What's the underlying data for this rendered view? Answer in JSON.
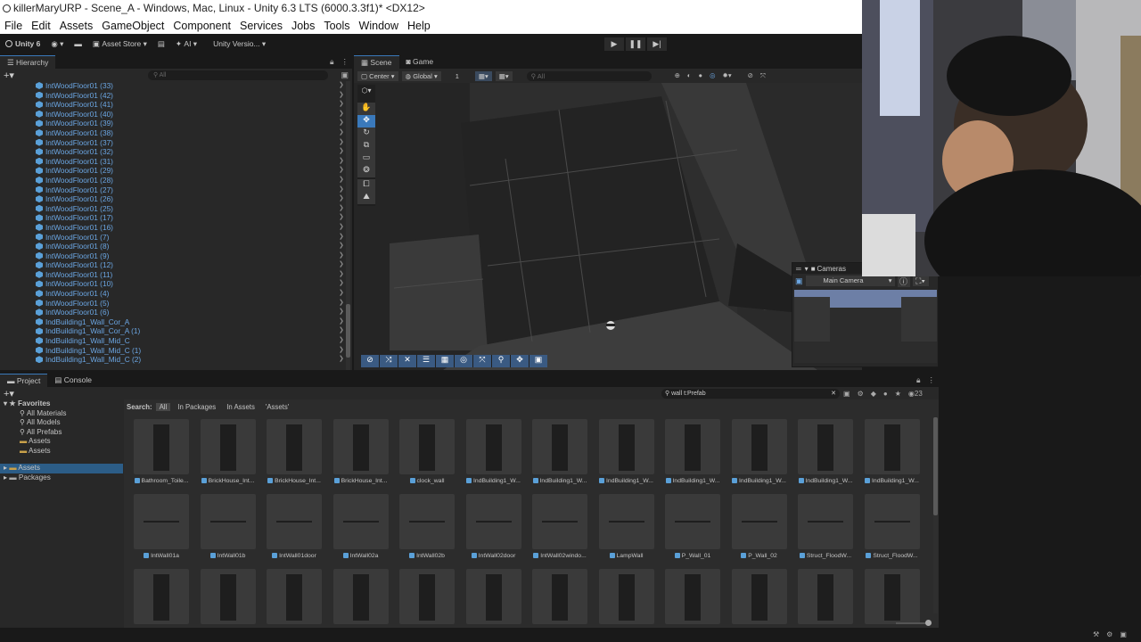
{
  "window": {
    "title": "killerMaryURP - Scene_A - Windows, Mac, Linux - Unity 6.3 LTS (6000.3.3f1)* <DX12>"
  },
  "menu": [
    "File",
    "Edit",
    "Assets",
    "GameObject",
    "Component",
    "Services",
    "Jobs",
    "Tools",
    "Window",
    "Help"
  ],
  "toolbar": {
    "unity_label": "Unity 6",
    "asset_store": "Asset Store",
    "ai": "AI",
    "version": "Unity Versio..."
  },
  "hierarchy": {
    "tab": "Hierarchy",
    "search_placeholder": "All",
    "items": [
      "IntWoodFloor01 (33)",
      "IntWoodFloor01 (42)",
      "IntWoodFloor01 (41)",
      "IntWoodFloor01 (40)",
      "IntWoodFloor01 (39)",
      "IntWoodFloor01 (38)",
      "IntWoodFloor01 (37)",
      "IntWoodFloor01 (32)",
      "IntWoodFloor01 (31)",
      "IntWoodFloor01 (29)",
      "IntWoodFloor01 (28)",
      "IntWoodFloor01 (27)",
      "IntWoodFloor01 (26)",
      "IntWoodFloor01 (25)",
      "IntWoodFloor01 (17)",
      "IntWoodFloor01 (16)",
      "IntWoodFloor01 (7)",
      "IntWoodFloor01 (8)",
      "IntWoodFloor01 (9)",
      "IntWoodFloor01 (12)",
      "IntWoodFloor01 (11)",
      "IntWoodFloor01 (10)",
      "IntWoodFloor01 (4)",
      "IntWoodFloor01 (5)",
      "IntWoodFloor01 (6)",
      "IndBuilding1_Wall_Cor_A",
      "IndBuilding1_Wall_Cor_A (1)",
      "IndBuilding1_Wall_Mid_C",
      "IndBuilding1_Wall_Mid_C (1)",
      "IndBuilding1_Wall_Mid_C (2)"
    ]
  },
  "scene": {
    "tab_scene": "Scene",
    "tab_game": "Game",
    "pivot": "Center",
    "space": "Global",
    "grid_value": "1",
    "search_placeholder": "All"
  },
  "cameras": {
    "title": "Cameras",
    "selected": "Main Camera"
  },
  "project": {
    "tab_project": "Project",
    "tab_console": "Console",
    "search_value": "wall t:Prefab",
    "count": "23",
    "search_label": "Search:",
    "filters": [
      "All",
      "In Packages",
      "In Assets",
      "'Assets'"
    ],
    "favorites_label": "Favorites",
    "favorites": [
      "All Materials",
      "All Models",
      "All Prefabs",
      "Assets",
      "Assets"
    ],
    "roots": [
      "Assets",
      "Packages"
    ],
    "assets_row1": [
      "Bathroom_Toile...",
      "BrickHouse_Int...",
      "BrickHouse_Int...",
      "BrickHouse_Int...",
      "clock_wall",
      "IndBuilding1_W...",
      "IndBuilding1_W...",
      "IndBuilding1_W...",
      "IndBuilding1_W...",
      "IndBuilding1_W...",
      "IndBuilding1_W...",
      "IndBuilding1_W..."
    ],
    "assets_row2": [
      "IntWall01a",
      "IntWall01b",
      "IntWall01door",
      "IntWall02a",
      "IntWall02b",
      "IntWall02door",
      "IntWall02windo...",
      "LampWall",
      "P_Wall_01",
      "P_Wall_02",
      "Struct_FloodW...",
      "Struct_FloodW..."
    ]
  },
  "colors": {
    "accent": "#3a79bb",
    "prefab_blue": "#6ba6e3"
  }
}
